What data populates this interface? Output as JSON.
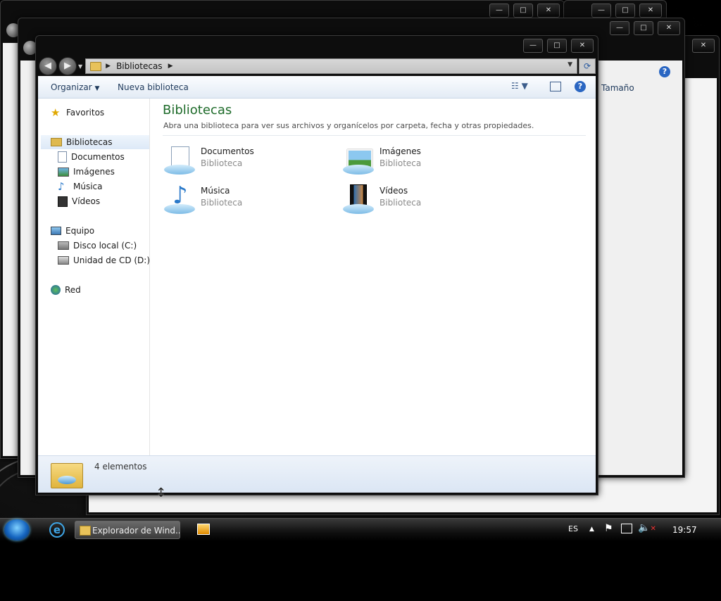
{
  "window": {
    "breadcrumb": "Bibliotecas",
    "toolbar": {
      "organize": "Organizar",
      "new_library": "Nueva biblioteca"
    },
    "caption": {
      "minimize": "—",
      "maximize": "□",
      "close": "✕"
    }
  },
  "navpane": {
    "favorites": "Favoritos",
    "libraries": "Bibliotecas",
    "library_items": [
      "Documentos",
      "Imágenes",
      "Música",
      "Vídeos"
    ],
    "computer": "Equipo",
    "drives": [
      "Disco local (C:)",
      "Unidad de CD (D:) C"
    ],
    "network": "Red"
  },
  "content": {
    "title": "Bibliotecas",
    "subtitle": "Abra una biblioteca para ver sus archivos y organícelos por carpeta, fecha y otras propiedades.",
    "libraries": [
      {
        "name": "Documentos",
        "type": "Biblioteca",
        "icon": "documents-library-icon"
      },
      {
        "name": "Imágenes",
        "type": "Biblioteca",
        "icon": "pictures-library-icon"
      },
      {
        "name": "Música",
        "type": "Biblioteca",
        "icon": "music-library-icon"
      },
      {
        "name": "Vídeos",
        "type": "Biblioteca",
        "icon": "videos-library-icon"
      }
    ]
  },
  "status": {
    "count": "4 elementos"
  },
  "background_window": {
    "column_header": "Tamaño"
  },
  "taskbar": {
    "explorer_button": "Explorador de Wind...",
    "language": "ES",
    "clock": "19:57"
  },
  "colors": {
    "title_green": "#1e6b2a",
    "toolbar_text": "#1e395b",
    "frame": "#0d0d0d"
  }
}
